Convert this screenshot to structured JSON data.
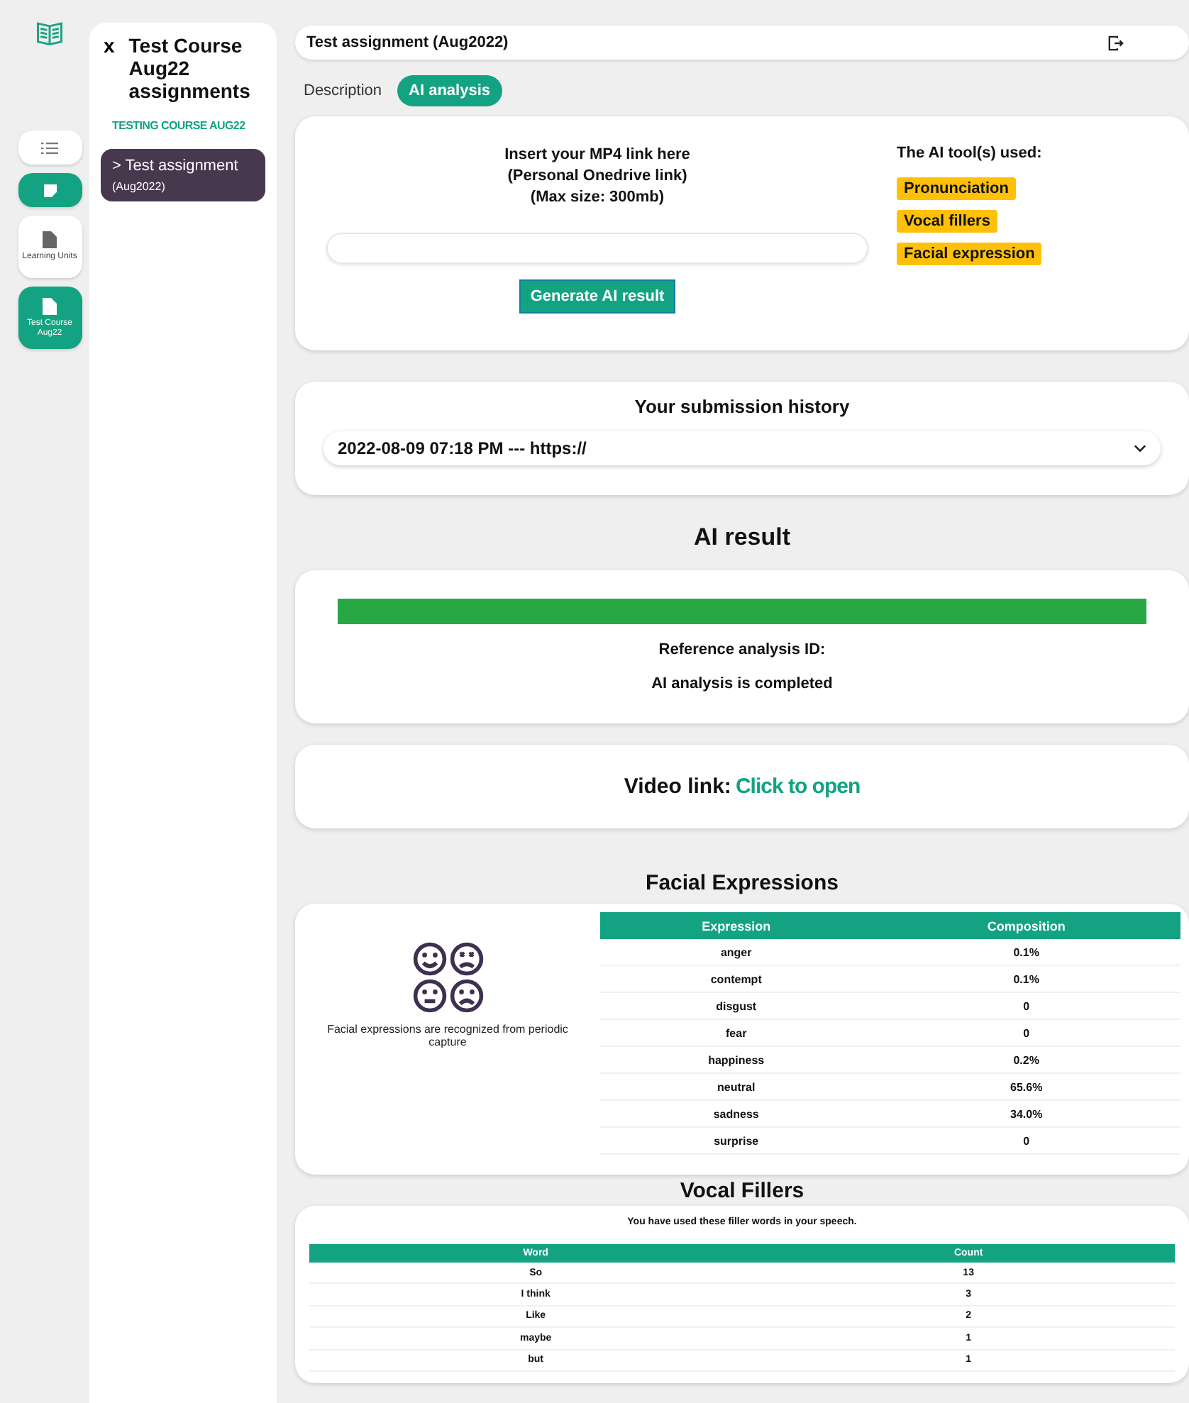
{
  "rail": {
    "items": [
      {
        "kind": "list",
        "selected": false
      },
      {
        "kind": "note",
        "selected": true
      },
      {
        "kind": "doc",
        "label": "Learning Units",
        "selected": false
      },
      {
        "kind": "doc",
        "label": "Test Course Aug22",
        "selected": true
      }
    ]
  },
  "sidebar": {
    "close": "x",
    "title": "Test Course Aug22 assignments",
    "course": "TESTING COURSE AUG22",
    "items": [
      {
        "title": "> Test assignment",
        "sub": "(Aug2022)",
        "selected": true
      }
    ]
  },
  "header": {
    "title": "Test assignment (Aug2022)"
  },
  "tabs": [
    {
      "label": "Description",
      "selected": false
    },
    {
      "label": "AI analysis",
      "selected": true
    }
  ],
  "upload": {
    "instructions": [
      "Insert your MP4 link here",
      "(Personal Onedrive link)",
      "(Max size: 300mb)"
    ],
    "button": "Generate AI result",
    "tools_title": "The AI  tool(s) used:",
    "tools": [
      "Pronunciation",
      "Vocal fillers",
      "Facial expression"
    ]
  },
  "history": {
    "title": "Your submission history",
    "selected_value": "2022-08-09 07:18 PM --- https://"
  },
  "result": {
    "title": "AI result",
    "progress": {
      "level": 1
    },
    "reference": "Reference analysis ID:",
    "status": "AI analysis is completed"
  },
  "video": {
    "label": "Video link:",
    "link": "Click to open"
  },
  "facial": {
    "title": "Facial Expressions",
    "caption": "Facial expressions are recognized from periodic capture",
    "columns": [
      "Expression",
      "Composition"
    ],
    "rows": [
      [
        "anger",
        "0.1%"
      ],
      [
        "contempt",
        "0.1%"
      ],
      [
        "disgust",
        "0"
      ],
      [
        "fear",
        "0"
      ],
      [
        "happiness",
        "0.2%"
      ],
      [
        "neutral",
        "65.6%"
      ],
      [
        "sadness",
        "34.0%"
      ],
      [
        "surprise",
        "0"
      ]
    ]
  },
  "vocal": {
    "title": "Vocal Fillers",
    "note": "You have used these filler words in your speech.",
    "columns": [
      "Word",
      "Count"
    ],
    "rows": [
      [
        "So",
        "13"
      ],
      [
        "I think",
        "3"
      ],
      [
        "Like",
        "2"
      ],
      [
        "maybe",
        "1"
      ],
      [
        "but",
        "1"
      ]
    ]
  }
}
